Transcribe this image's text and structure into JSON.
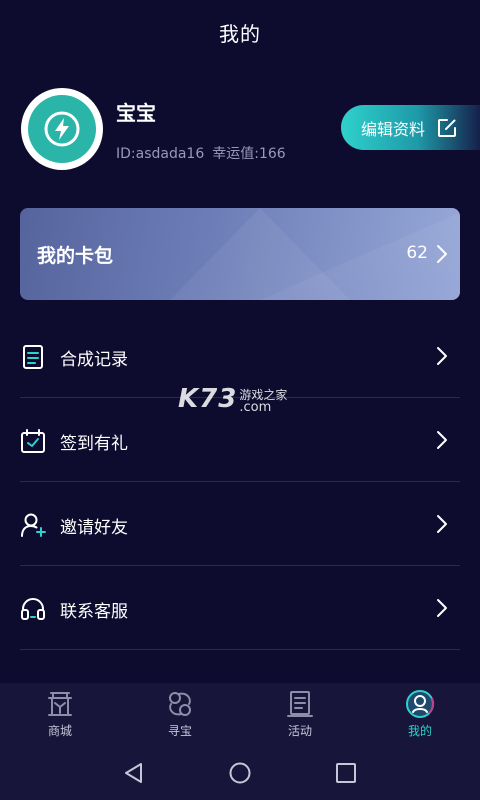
{
  "header": {
    "title": "我的"
  },
  "profile": {
    "name": "宝宝",
    "id_text": "ID:asdada16",
    "luck_text": "幸运值:166",
    "edit_label": "编辑资料",
    "avatar_icon": "lightning-icon"
  },
  "card": {
    "title": "我的卡包",
    "count": "62"
  },
  "menu": [
    {
      "label": "合成记录",
      "icon": "document-icon"
    },
    {
      "label": "签到有礼",
      "icon": "calendar-check-icon"
    },
    {
      "label": "邀请好友",
      "icon": "add-user-icon"
    },
    {
      "label": "联系客服",
      "icon": "headset-icon"
    }
  ],
  "watermark": {
    "brand": "K73",
    "line1": "游戏之家",
    "line2": ".com"
  },
  "bottom_nav": [
    {
      "label": "商城",
      "icon": "shop-icon",
      "active": false
    },
    {
      "label": "寻宝",
      "icon": "treasure-icon",
      "active": false
    },
    {
      "label": "活动",
      "icon": "activity-icon",
      "active": false
    },
    {
      "label": "我的",
      "icon": "profile-icon",
      "active": true
    }
  ],
  "colors": {
    "background": "#0d0b2e",
    "accent": "#2fd1cc",
    "avatar_bg": "#2bb5a8",
    "nav_bg": "#17163a"
  }
}
